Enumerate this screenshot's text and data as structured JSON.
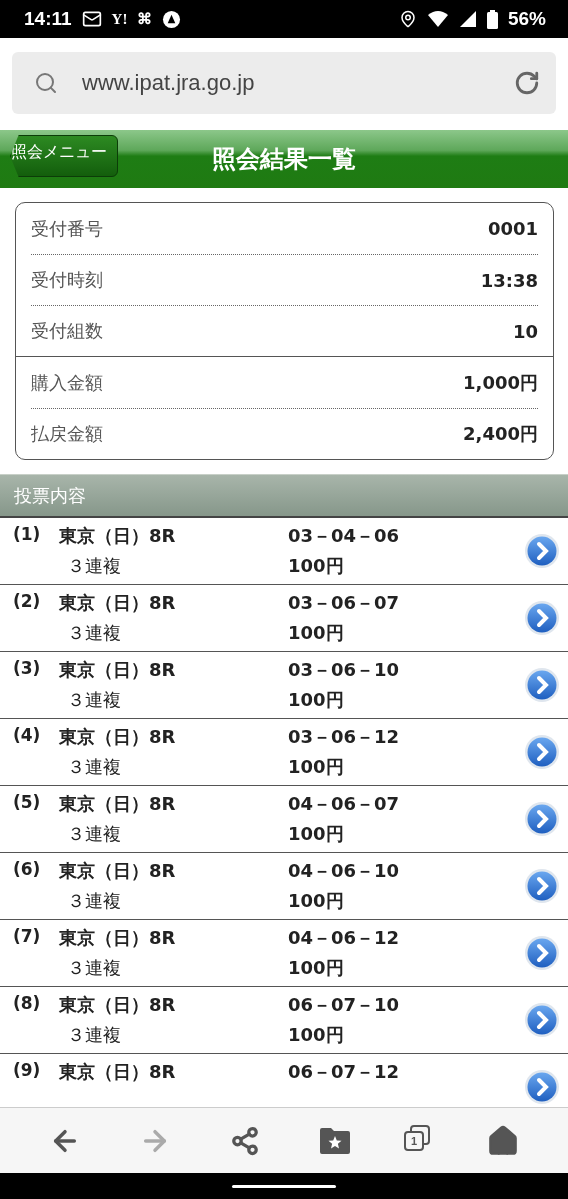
{
  "status_bar": {
    "time": "14:11",
    "notification_glyphs": [
      "Y!",
      "⌘"
    ],
    "battery": "56%"
  },
  "browser": {
    "url": "www.ipat.jra.go.jp"
  },
  "header": {
    "back_button": "照会メニュー",
    "title": "照会結果一覧"
  },
  "summary": {
    "groups": [
      [
        {
          "label": "受付番号",
          "value": "0001"
        },
        {
          "label": "受付時刻",
          "value": "13:38"
        },
        {
          "label": "受付組数",
          "value": "10"
        }
      ],
      [
        {
          "label": "購入金額",
          "value": "1,000円"
        },
        {
          "label": "払戻金額",
          "value": "2,400円"
        }
      ]
    ]
  },
  "section_title": "投票内容",
  "bets": [
    {
      "index": "(1)",
      "race": "東京（日）8R",
      "type": "３連複",
      "numbers": "03－04－06",
      "amount": "100円"
    },
    {
      "index": "(2)",
      "race": "東京（日）8R",
      "type": "３連複",
      "numbers": "03－06－07",
      "amount": "100円"
    },
    {
      "index": "(3)",
      "race": "東京（日）8R",
      "type": "３連複",
      "numbers": "03－06－10",
      "amount": "100円"
    },
    {
      "index": "(4)",
      "race": "東京（日）8R",
      "type": "３連複",
      "numbers": "03－06－12",
      "amount": "100円"
    },
    {
      "index": "(5)",
      "race": "東京（日）8R",
      "type": "３連複",
      "numbers": "04－06－07",
      "amount": "100円"
    },
    {
      "index": "(6)",
      "race": "東京（日）8R",
      "type": "３連複",
      "numbers": "04－06－10",
      "amount": "100円"
    },
    {
      "index": "(7)",
      "race": "東京（日）8R",
      "type": "３連複",
      "numbers": "04－06－12",
      "amount": "100円"
    },
    {
      "index": "(8)",
      "race": "東京（日）8R",
      "type": "３連複",
      "numbers": "06－07－10",
      "amount": "100円"
    },
    {
      "index": "(9)",
      "race": "東京（日）8R",
      "numbers": "06－07－12"
    }
  ],
  "toolbar": {
    "forward_disabled": true,
    "tab_count": "1"
  }
}
